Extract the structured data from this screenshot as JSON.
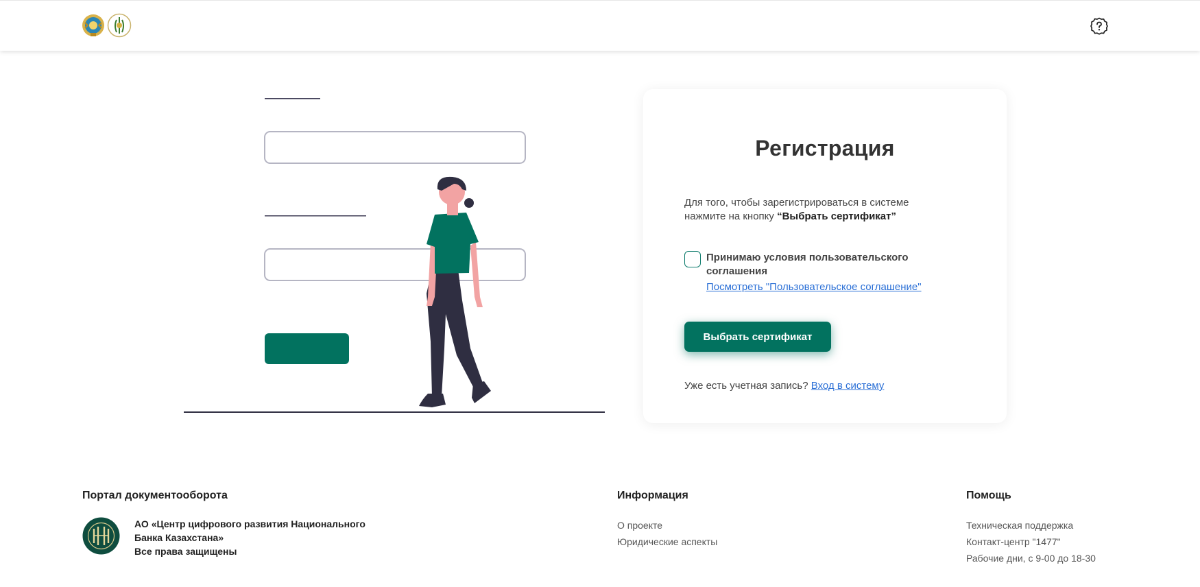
{
  "colors": {
    "accent": "#02725f",
    "link": "#2a6fd6",
    "illus_skin": "#f2a3a3",
    "illus_pants": "#2f2e41"
  },
  "header": {
    "logo_icons": [
      "kazakhstan-emblem-icon",
      "national-bank-logo-icon"
    ],
    "help_icon": "question-circle-icon"
  },
  "card": {
    "title": "Регистрация",
    "desc_line1": "Для того, чтобы зарегистрироваться в системе",
    "desc_line2_prefix": "нажмите на кнопку ",
    "desc_line2_bold": "“Выбрать сертификат”",
    "agree_label": "Принимаю условия пользовательского соглашения",
    "agree_checked": false,
    "agreement_link": "Посмотреть \"Пользовательское соглашение\"",
    "select_cert_button": "Выбрать сертификат",
    "have_account_text": "Уже есть учетная запись?",
    "login_link": "Вход в систему"
  },
  "footer": {
    "col1": {
      "heading": "Портал документооборота",
      "org_line1": "АО «Центр цифрового развития Национального",
      "org_line2": "Банка Казахстана»",
      "org_line3": "Все права защищены"
    },
    "col2": {
      "heading": "Информация",
      "links": [
        "О проекте",
        "Юридические аспекты"
      ]
    },
    "col3": {
      "heading": "Помощь",
      "links": [
        "Техническая поддержка",
        "Контакт-центр \"1477\"",
        "Рабочие дни, с 9-00 до 18-30"
      ]
    }
  }
}
